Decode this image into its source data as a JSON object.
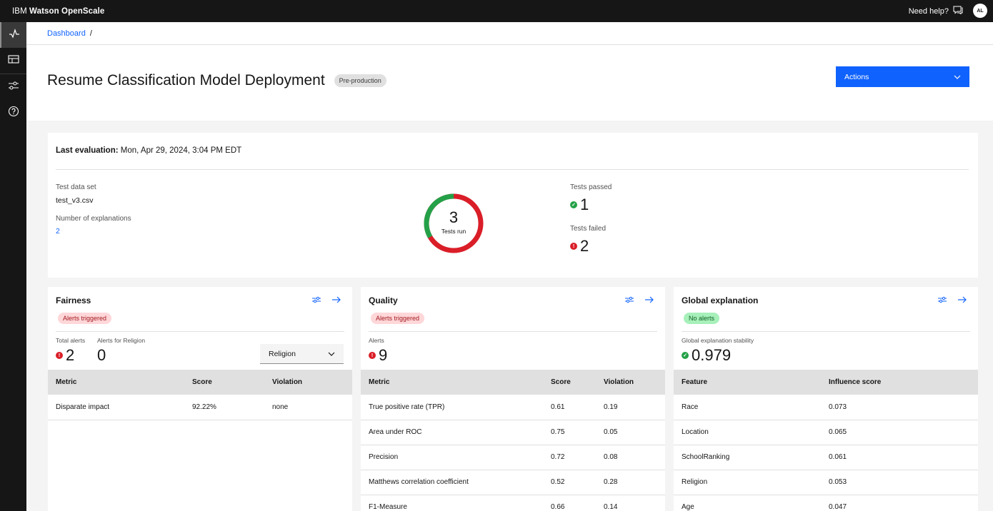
{
  "header": {
    "brand_prefix": "IBM",
    "brand_name": "Watson OpenScale",
    "help_label": "Need help?",
    "avatar_initials": "AL"
  },
  "breadcrumb": {
    "root": "Dashboard",
    "separator": "/"
  },
  "page": {
    "title": "Resume Classification Model Deployment",
    "env_tag": "Pre-production",
    "actions_label": "Actions"
  },
  "summary": {
    "last_eval_label": "Last evaluation:",
    "last_eval_value": "Mon, Apr 29, 2024, 3:04 PM EDT",
    "dataset_label": "Test data set",
    "dataset_value": "test_v3.csv",
    "explanations_label": "Number of explanations",
    "explanations_value": "2",
    "tests_run": "3",
    "tests_run_label": "Tests run",
    "tests_passed_label": "Tests passed",
    "tests_passed": "1",
    "tests_failed_label": "Tests failed",
    "tests_failed": "2",
    "colors": {
      "pass": "#24a148",
      "fail": "#da1e28"
    }
  },
  "fairness": {
    "title": "Fairness",
    "status": "Alerts triggered",
    "total_alerts_label": "Total alerts",
    "total_alerts": "2",
    "religion_alerts_label": "Alerts for Religion",
    "religion_alerts": "0",
    "select_value": "Religion",
    "columns": [
      "Metric",
      "Score",
      "Violation"
    ],
    "rows": [
      [
        "Disparate impact",
        "92.22%",
        "none"
      ]
    ]
  },
  "quality": {
    "title": "Quality",
    "status": "Alerts triggered",
    "alerts_label": "Alerts",
    "alerts": "9",
    "columns": [
      "Metric",
      "Score",
      "Violation"
    ],
    "rows": [
      [
        "True positive rate (TPR)",
        "0.61",
        "0.19"
      ],
      [
        "Area under ROC",
        "0.75",
        "0.05"
      ],
      [
        "Precision",
        "0.72",
        "0.08"
      ],
      [
        "Matthews correlation coefficient",
        "0.52",
        "0.28"
      ],
      [
        "F1-Measure",
        "0.66",
        "0.14"
      ]
    ]
  },
  "explanation": {
    "title": "Global explanation",
    "status": "No alerts",
    "stability_label": "Global explanation stability",
    "stability": "0.979",
    "columns": [
      "Feature",
      "Influence score"
    ],
    "rows": [
      [
        "Race",
        "0.073"
      ],
      [
        "Location",
        "0.065"
      ],
      [
        "SchoolRanking",
        "0.061"
      ],
      [
        "Religion",
        "0.053"
      ],
      [
        "Age",
        "0.047"
      ]
    ]
  }
}
